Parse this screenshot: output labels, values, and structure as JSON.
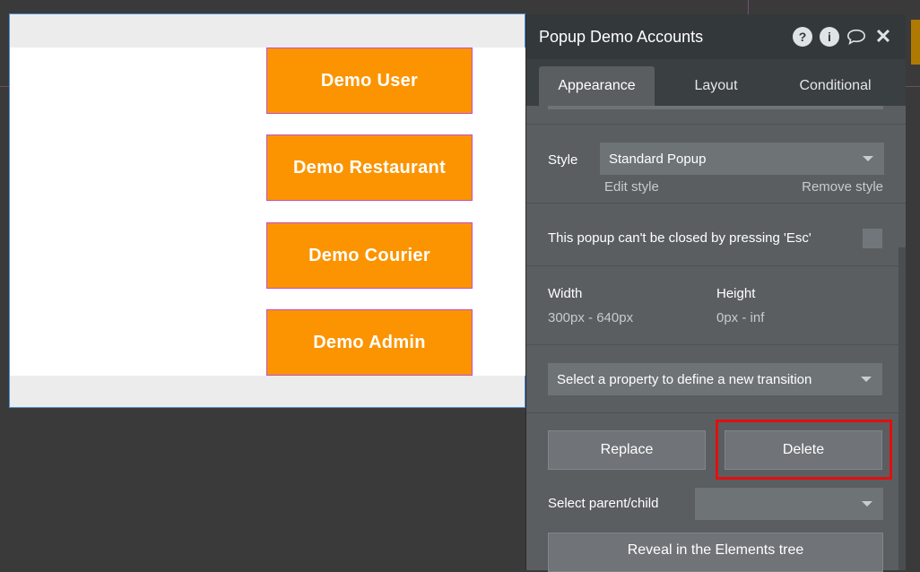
{
  "canvas": {
    "buttons": [
      {
        "label": "Demo User"
      },
      {
        "label": "Demo Restaurant"
      },
      {
        "label": "Demo Courier"
      },
      {
        "label": "Demo Admin"
      }
    ],
    "button_color": "#fb9400"
  },
  "panel": {
    "title": "Popup Demo Accounts",
    "icons": [
      "help-icon",
      "info-icon",
      "comment-icon",
      "close-icon"
    ],
    "tabs": [
      {
        "label": "Appearance",
        "active": true
      },
      {
        "label": "Layout",
        "active": false
      },
      {
        "label": "Conditional",
        "active": false
      }
    ],
    "style": {
      "label": "Style",
      "value": "Standard Popup",
      "edit": "Edit style",
      "remove": "Remove style"
    },
    "esc": {
      "label": "This popup can't be closed by pressing 'Esc'"
    },
    "width": {
      "label": "Width",
      "value": "300px - 640px"
    },
    "height": {
      "label": "Height",
      "value": "0px - inf"
    },
    "transition": {
      "placeholder": "Select a property to define a new transition"
    },
    "actions": {
      "replace": "Replace",
      "delete": "Delete"
    },
    "parent_child": {
      "label": "Select parent/child",
      "value": ""
    },
    "reveal": "Reveal in the Elements tree",
    "highlight_color": "#e01010"
  }
}
